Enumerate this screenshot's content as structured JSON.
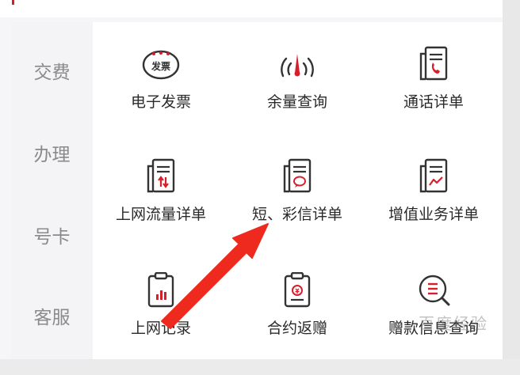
{
  "sidebar": {
    "items": [
      {
        "label": "交费"
      },
      {
        "label": "办理"
      },
      {
        "label": "号卡"
      },
      {
        "label": "客服"
      }
    ]
  },
  "grid": {
    "items": [
      {
        "label": "电子发票",
        "icon": "invoice-icon",
        "icon_text": "发票"
      },
      {
        "label": "余量查询",
        "icon": "gauge-icon"
      },
      {
        "label": "通话详单",
        "icon": "call-record-icon"
      },
      {
        "label": "上网流量详单",
        "icon": "data-traffic-icon"
      },
      {
        "label": "短、彩信详单",
        "icon": "sms-record-icon"
      },
      {
        "label": "增值业务详单",
        "icon": "value-added-icon"
      },
      {
        "label": "上网记录",
        "icon": "clipboard-chart-icon"
      },
      {
        "label": "合约返赠",
        "icon": "contract-icon"
      },
      {
        "label": "赠款信息查询",
        "icon": "search-list-icon"
      }
    ]
  },
  "watermark": {
    "text": "百度经验"
  },
  "colors": {
    "accent": "#d81e2a",
    "icon_stroke": "#333333",
    "arrow": "#ee2a1e"
  }
}
